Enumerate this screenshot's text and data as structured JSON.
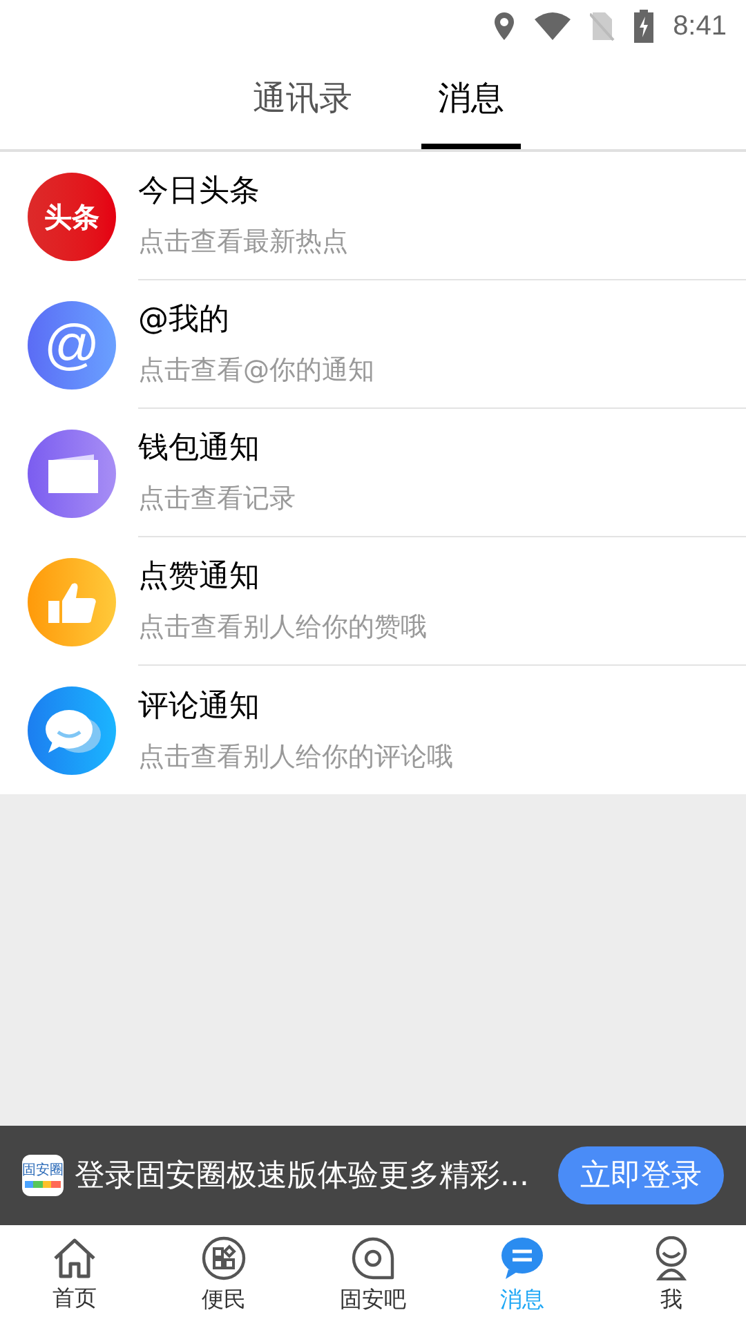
{
  "status_bar": {
    "time": "8:41"
  },
  "tabs": [
    {
      "label": "通讯录",
      "selected": false
    },
    {
      "label": "消息",
      "selected": true
    }
  ],
  "messages": [
    {
      "kind": "headline",
      "icon_text": "头条",
      "title": "今日头条",
      "subtitle": "点击查看最新热点"
    },
    {
      "kind": "mention",
      "icon_text": "@",
      "title": "@我的",
      "subtitle": "点击查看@你的通知"
    },
    {
      "kind": "wallet",
      "title": "钱包通知",
      "subtitle": "点击查看记录"
    },
    {
      "kind": "like",
      "title": "点赞通知",
      "subtitle": "点击查看别人给你的赞哦"
    },
    {
      "kind": "comment",
      "title": "评论通知",
      "subtitle": "点击查看别人给你的评论哦"
    }
  ],
  "login_banner": {
    "app_icon_text": "固安圈",
    "text": "登录固安圈极速版体验更多精彩...",
    "button": "立即登录"
  },
  "bottom_nav": [
    {
      "kind": "home",
      "label": "首页",
      "selected": false
    },
    {
      "kind": "services",
      "label": "便民",
      "selected": false
    },
    {
      "kind": "forum",
      "label": "固安吧",
      "selected": false
    },
    {
      "kind": "messages",
      "label": "消息",
      "selected": true
    },
    {
      "kind": "me",
      "label": "我",
      "selected": false
    }
  ]
}
